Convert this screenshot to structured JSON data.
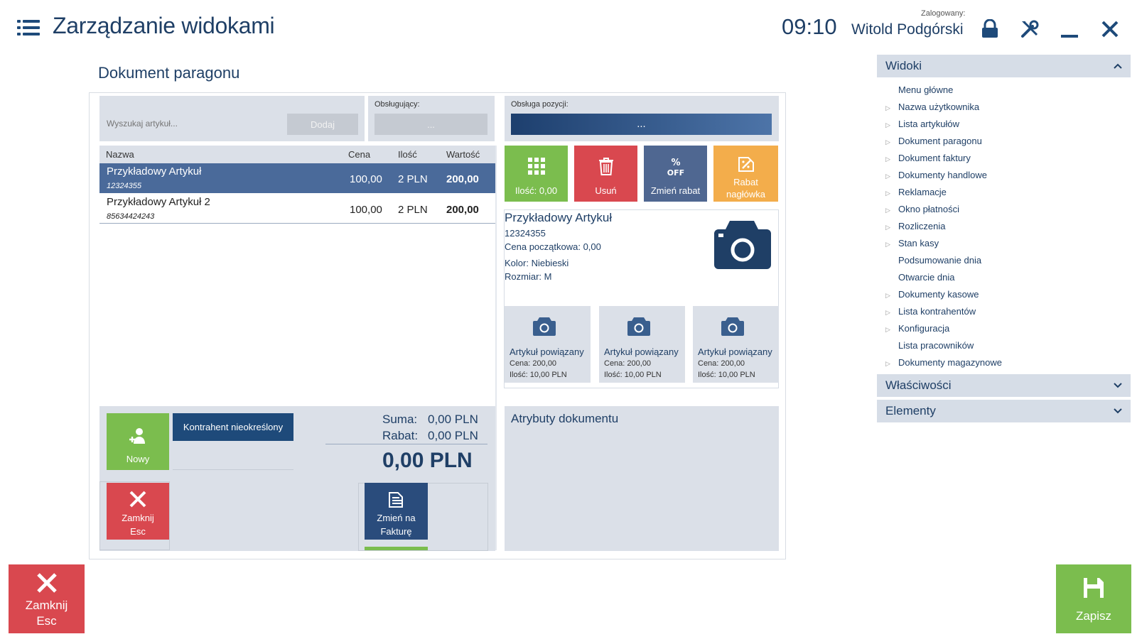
{
  "header": {
    "title": "Zarządzanie widokami",
    "time": "09:10",
    "logged_label": "Zalogowany:",
    "user_name": "Witold Podgórski"
  },
  "section_title": "Dokument paragonu",
  "search": {
    "placeholder": "Wyszukaj artykuł...",
    "add_label": "Dodaj"
  },
  "cashier": {
    "label": "Obsługujący:",
    "value": "..."
  },
  "item_handling": {
    "label": "Obsługa pozycji:",
    "value": "..."
  },
  "table": {
    "headers": [
      "Nazwa",
      "Cena",
      "Ilość",
      "Wartość"
    ],
    "rows": [
      {
        "name": "Przykładowy Artykuł",
        "code": "12324355",
        "price": "100,00",
        "qty": "2 PLN",
        "value": "200,00",
        "selected": true
      },
      {
        "name": "Przykładowy Artykuł 2",
        "code": "85634424243",
        "price": "100,00",
        "qty": "2 PLN",
        "value": "200,00",
        "selected": false
      }
    ]
  },
  "actions": [
    {
      "label": "Ilość: 0,00",
      "icon": "grid-icon",
      "color": "#7bbd4e"
    },
    {
      "label": "Usuń",
      "icon": "trash-icon",
      "color": "#d9484f"
    },
    {
      "label": "Zmień rabat",
      "icon": "percent-off-icon",
      "color": "#4f6791"
    },
    {
      "label": "Rabat nagłówka",
      "icon": "edit-discount-icon",
      "color": "#f3ad4b"
    }
  ],
  "details": {
    "name": "Przykładowy Artykuł",
    "code": "12324355",
    "initial_price": "Cena początkowa: 0,00",
    "color": "Kolor: Niebieski",
    "size": "Rozmiar: M"
  },
  "related": [
    {
      "title": "Artykuł powiązany",
      "price": "Cena: 200,00",
      "qty": "Ilość: 10,00 PLN"
    },
    {
      "title": "Artykuł powiązany",
      "price": "Cena: 200,00",
      "qty": "Ilość: 10,00 PLN"
    },
    {
      "title": "Artykuł powiązany",
      "price": "Cena: 200,00",
      "qty": "Ilość: 10,00 PLN"
    }
  ],
  "bottom": {
    "new_label": "Nowy",
    "contractor_label": "Kontrahent nieokreślony",
    "close_label_1": "Zamknij",
    "close_label_2": "Esc",
    "invoice_label_1": "Zmień na",
    "invoice_label_2": "Fakturę",
    "sum_label": "Suma:",
    "sum_value": "0,00 PLN",
    "discount_label": "Rabat:",
    "discount_value": "0,00 PLN",
    "total": "0,00 PLN"
  },
  "attributes_title": "Atrybuty dokumentu",
  "right_panel": {
    "views_title": "Widoki",
    "items": [
      {
        "label": "Menu główne",
        "expandable": false
      },
      {
        "label": "Nazwa użytkownika",
        "expandable": true
      },
      {
        "label": "Lista artykułów",
        "expandable": true
      },
      {
        "label": "Dokument paragonu",
        "expandable": true
      },
      {
        "label": "Dokument faktury",
        "expandable": true
      },
      {
        "label": "Dokumenty handlowe",
        "expandable": true
      },
      {
        "label": "Reklamacje",
        "expandable": true
      },
      {
        "label": "Okno płatności",
        "expandable": true
      },
      {
        "label": "Rozliczenia",
        "expandable": true
      },
      {
        "label": "Stan kasy",
        "expandable": true
      },
      {
        "label": "Podsumowanie dnia",
        "expandable": false
      },
      {
        "label": "Otwarcie dnia",
        "expandable": false
      },
      {
        "label": "Dokumenty kasowe",
        "expandable": true
      },
      {
        "label": "Lista kontrahentów",
        "expandable": true
      },
      {
        "label": "Konfiguracja",
        "expandable": true
      },
      {
        "label": "Lista pracowników",
        "expandable": false
      },
      {
        "label": "Dokumenty magazynowe",
        "expandable": true
      }
    ],
    "properties_title": "Właściwości",
    "elements_title": "Elementy"
  },
  "footer": {
    "close_label_1": "Zamknij",
    "close_label_2": "Esc",
    "save_label": "Zapisz"
  },
  "colors": {
    "accent_dark": "#1e4a7a",
    "selected_row": "#4a6a9a",
    "green": "#7bbd4e",
    "red": "#d9484f"
  }
}
